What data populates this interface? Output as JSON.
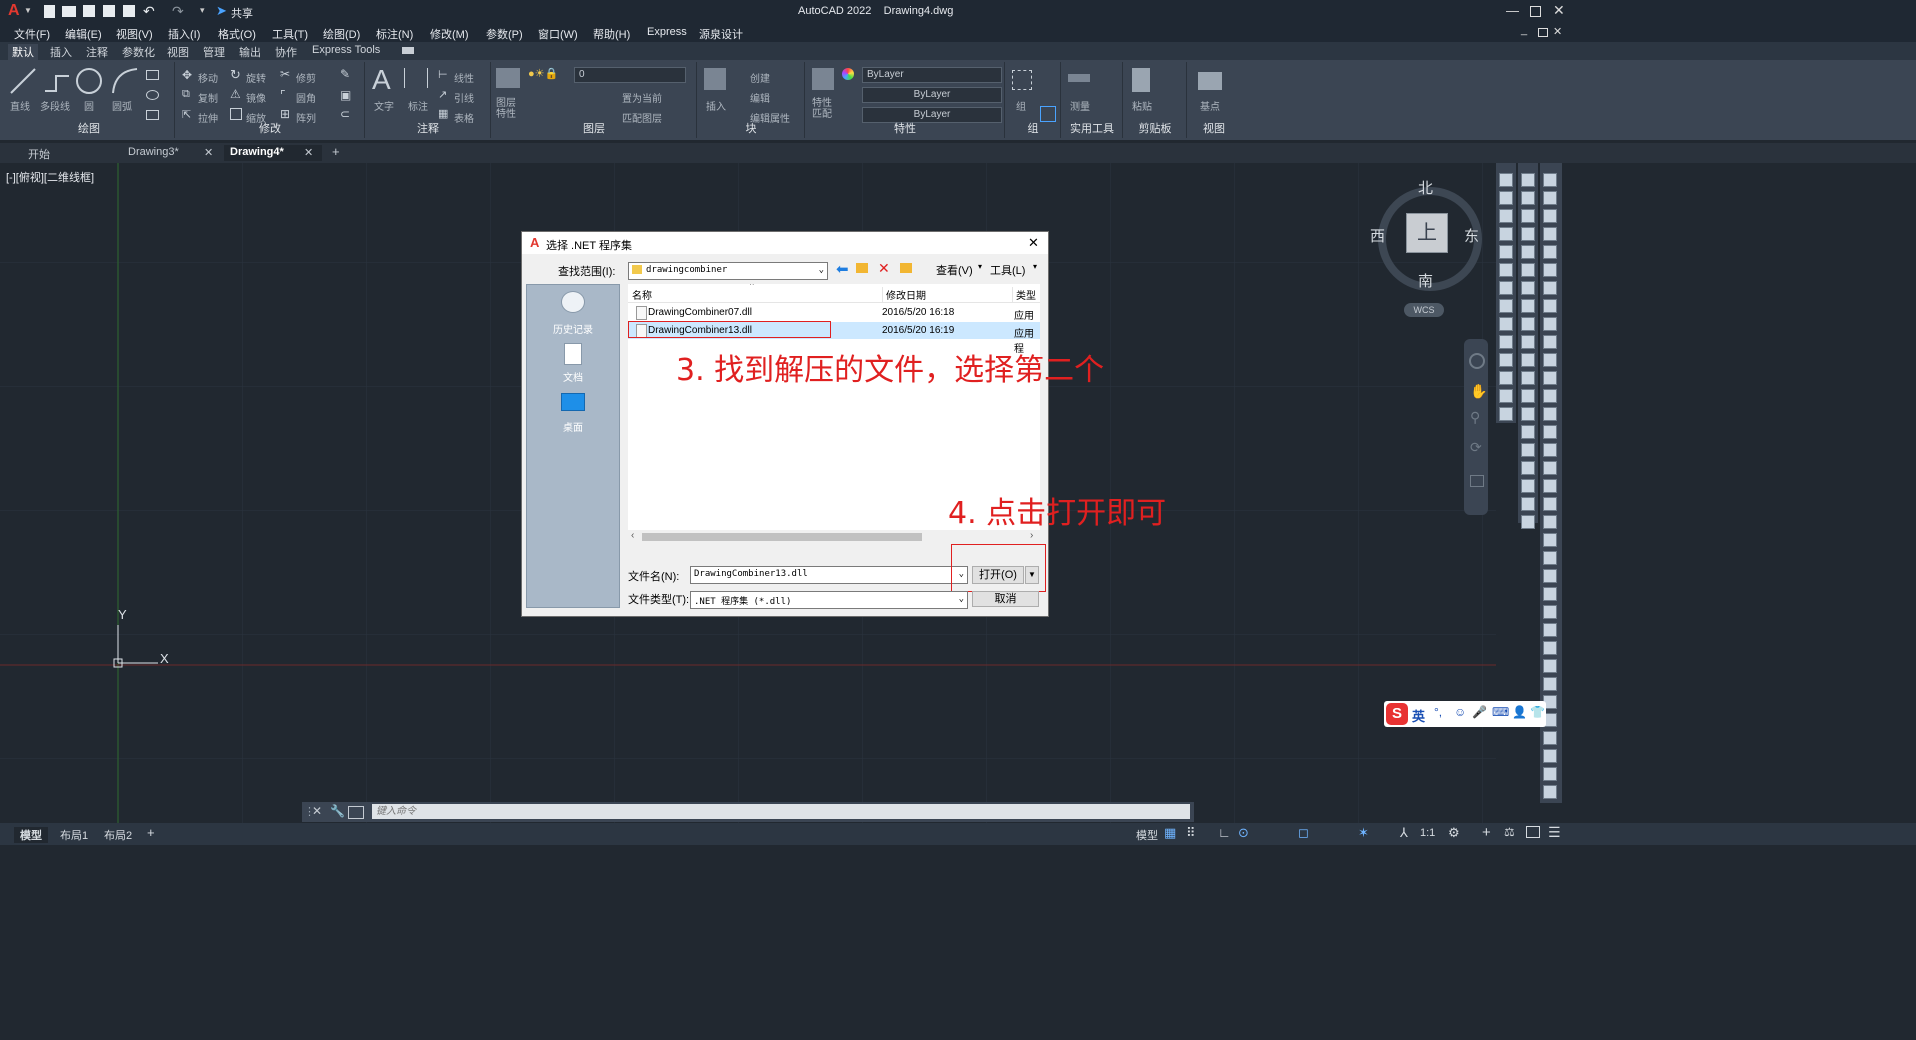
{
  "app": {
    "title": "AutoCAD 2022",
    "document": "Drawing4.dwg",
    "logo": "A",
    "share": "共享"
  },
  "menu": [
    "文件(F)",
    "编辑(E)",
    "视图(V)",
    "插入(I)",
    "格式(O)",
    "工具(T)",
    "绘图(D)",
    "标注(N)",
    "修改(M)",
    "参数(P)",
    "窗口(W)",
    "帮助(H)",
    "Express",
    "源泉设计"
  ],
  "ribbon_tabs": [
    "默认",
    "插入",
    "注释",
    "参数化",
    "视图",
    "管理",
    "输出",
    "协作",
    "Express Tools"
  ],
  "ribbon": {
    "draw": {
      "title": "绘图",
      "line": "直线",
      "polyline": "多段线",
      "circle": "圆",
      "arc": "圆弧"
    },
    "modify": {
      "title": "修改",
      "move": "移动",
      "rotate": "旋转",
      "trim": "修剪",
      "copy": "复制",
      "mirror": "镜像",
      "fillet": "圆角",
      "stretch": "拉伸",
      "scale": "缩放",
      "array": "阵列"
    },
    "annotation": {
      "title": "注释",
      "text": "文字",
      "dimension": "标注",
      "linear": "线性",
      "leader": "引线",
      "table": "表格"
    },
    "layers": {
      "title": "图层",
      "layer_props": "图层特性",
      "current_layer": "0",
      "set_current": "置为当前",
      "match_layer": "匹配图层"
    },
    "block": {
      "title": "块",
      "insert": "插入",
      "create": "创建",
      "edit": "编辑",
      "edit_attr": "编辑属性"
    },
    "properties": {
      "title": "特性",
      "match": "特性匹配",
      "color": "ByLayer",
      "linetype": "ByLayer",
      "lineweight": "ByLayer"
    },
    "group": {
      "title": "组",
      "group": "组"
    },
    "utilities": {
      "title": "实用工具",
      "measure": "测量"
    },
    "clipboard": {
      "title": "剪贴板",
      "paste": "粘贴"
    },
    "view": {
      "title": "视图",
      "base": "基点"
    }
  },
  "doc_tabs": [
    "开始",
    "Drawing3*",
    "Drawing4*"
  ],
  "viewport_label": "[-][俯视][二维线框]",
  "viewcube": {
    "north": "北",
    "south": "南",
    "east": "东",
    "west": "西",
    "top": "上",
    "wcs": "WCS"
  },
  "ucs": {
    "x": "X",
    "y": "Y"
  },
  "dialog": {
    "title": "选择 .NET 程序集",
    "lookin_label": "查找范围(I):",
    "lookin_value": "drawingcombiner",
    "view_label": "查看(V)",
    "tools_label": "工具(L)",
    "places": [
      "历史记录",
      "文档",
      "桌面"
    ],
    "columns": [
      "名称",
      "修改日期",
      "类型"
    ],
    "files": [
      {
        "name": "DrawingCombiner07.dll",
        "date": "2016/5/20 16:18",
        "type": "应用程"
      },
      {
        "name": "DrawingCombiner13.dll",
        "date": "2016/5/20 16:19",
        "type": "应用程"
      }
    ],
    "filename_label": "文件名(N):",
    "filename_value": "DrawingCombiner13.dll",
    "filetype_label": "文件类型(T):",
    "filetype_value": ".NET 程序集 (*.dll)",
    "open": "打开(O)",
    "cancel": "取消"
  },
  "annotations": {
    "step3": "3. 找到解压的文件，选择第二个",
    "step4": "4. 点击打开即可"
  },
  "command": {
    "placeholder": "键入命令"
  },
  "layout_tabs": [
    "模型",
    "布局1",
    "布局2"
  ],
  "status": {
    "model": "模型",
    "scale": "1:1"
  },
  "ime": {
    "label": "英"
  },
  "colors": {
    "annotation": "#e02020",
    "selection": "#cce8ff",
    "canvas": "#212830"
  }
}
